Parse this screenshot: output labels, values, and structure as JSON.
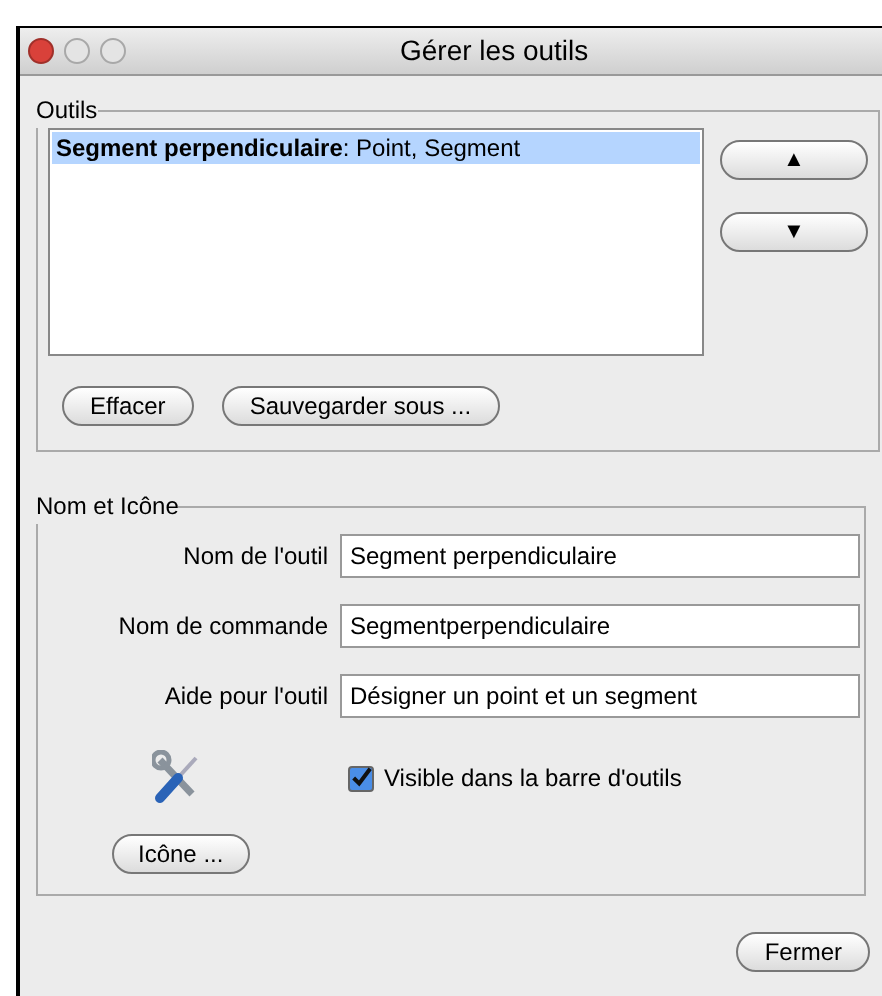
{
  "window": {
    "title": "Gérer les outils"
  },
  "tools_group": {
    "legend": "Outils",
    "items": [
      {
        "label": "**Segment perpendiculaire**: Point, Segment",
        "selected": true
      }
    ],
    "move_buttons": [
      "▲",
      "▼"
    ],
    "buttons": [
      "Effacer",
      "Sauvegarder sous ..."
    ]
  },
  "name_group": {
    "legend": "Nom et Icône",
    "fields": [
      {
        "label": "Nom de l'outil",
        "value": "Segment perpendiculaire"
      },
      {
        "label": "Nom de commande",
        "value": "Segmentperpendiculaire"
      },
      {
        "label": "Aide pour l'outil",
        "value": "Désigner un point et un segment"
      }
    ],
    "visible_checkbox": {
      "label": "Visible dans la barre d'outils",
      "checked": true
    },
    "icon_button": "Icône ..."
  },
  "footer_buttons": [
    "Fermer"
  ]
}
